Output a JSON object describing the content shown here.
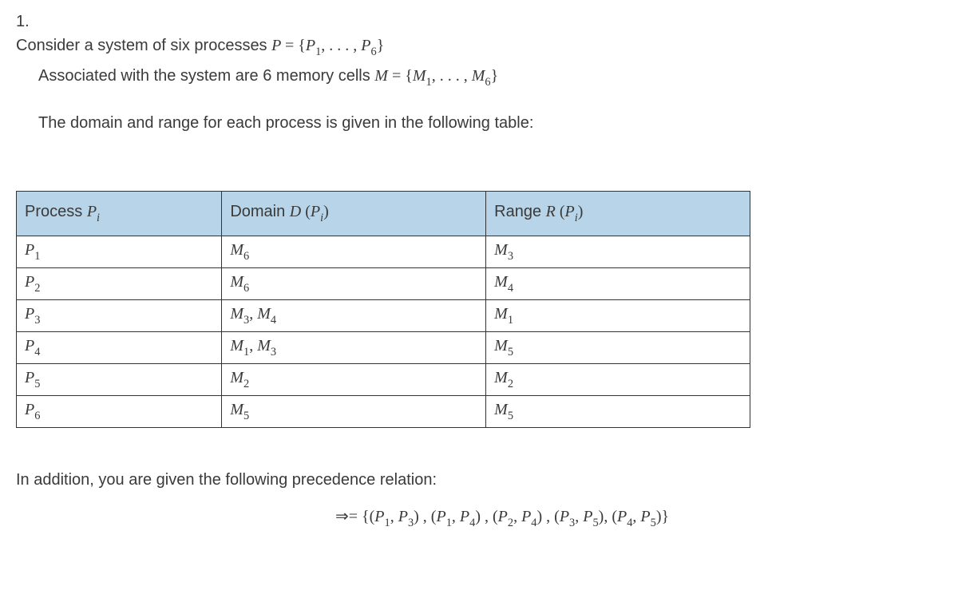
{
  "problem": {
    "number": "1.",
    "line1_a": "Consider a system of six processes ",
    "line1_math": "P = {P₁, . . . , P₆}",
    "line2_a": "Associated with the system are 6 memory cells ",
    "line2_math": "M = {M₁, . . . , M₆}",
    "line3": "The domain and range for each process is given in the following table:"
  },
  "table": {
    "headers": {
      "process_label": "Process ",
      "process_math": "Pᵢ",
      "domain_label": "Domain ",
      "domain_math": "D (Pᵢ)",
      "range_label": "Range ",
      "range_math": "R (Pᵢ)"
    },
    "rows": [
      {
        "process": "P₁",
        "domain": "M₆",
        "range": "M₃"
      },
      {
        "process": "P₂",
        "domain": "M₆",
        "range": "M₄"
      },
      {
        "process": "P₃",
        "domain": "M₃, M₄",
        "range": "M₁"
      },
      {
        "process": "P₄",
        "domain": "M₁, M₃",
        "range": "M₅"
      },
      {
        "process": "P₅",
        "domain": "M₂",
        "range": "M₂"
      },
      {
        "process": "P₆",
        "domain": "M₅",
        "range": "M₅"
      }
    ]
  },
  "footer": {
    "text": "In addition, you are given the following precedence relation:",
    "relation": "⇒= {(P₁, P₃) , (P₁, P₄) , (P₂, P₄) , (P₃, P₅), (P₄, P₅)}"
  }
}
